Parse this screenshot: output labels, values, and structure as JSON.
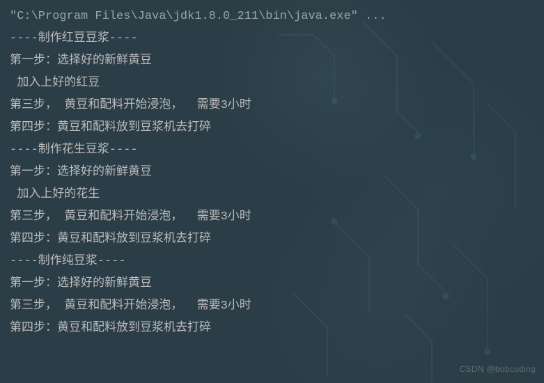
{
  "console": {
    "command": "\"C:\\Program Files\\Java\\jdk1.8.0_211\\bin\\java.exe\" ...",
    "lines": [
      "----制作红豆豆浆----",
      "第一步：选择好的新鲜黄豆",
      " 加入上好的红豆",
      "第三步， 黄豆和配料开始浸泡，  需要3小时",
      "第四步：黄豆和配料放到豆浆机去打碎",
      "----制作花生豆浆----",
      "第一步：选择好的新鲜黄豆",
      " 加入上好的花生",
      "第三步， 黄豆和配料开始浸泡，  需要3小时",
      "第四步：黄豆和配料放到豆浆机去打碎",
      "----制作纯豆浆----",
      "第一步：选择好的新鲜黄豆",
      "第三步， 黄豆和配料开始浸泡，  需要3小时",
      "第四步：黄豆和配料放到豆浆机去打碎"
    ]
  },
  "watermark": "CSDN @bobcoding"
}
